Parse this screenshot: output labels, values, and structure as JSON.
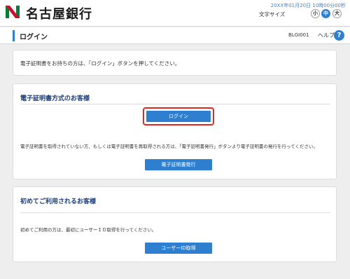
{
  "header": {
    "logo_icon": "bank-logo-icon",
    "bank_name": "名古屋銀行",
    "datetime": "20XX年01月20日 10時00分00秒",
    "font_size_label": "文字サイズ",
    "font_small": "小",
    "font_medium": "中",
    "font_large": "大",
    "brand_color": "#0a7a3a",
    "accent_color": "#2f7fd0"
  },
  "titlebar": {
    "title": "ログイン",
    "screen_id": "BLGI001",
    "help_label": "ヘルプ",
    "help_icon_glyph": "?"
  },
  "notice": {
    "text": "電子証明書をお持ちの方は、「ログイン」ボタンを押してください。"
  },
  "certificate_section": {
    "title": "電子証明書方式のお客様",
    "login_button": "ログイン",
    "description": "電子証明書を取得されていない方、もしくは電子証明書を再取得される方は、「電子証明書発行」ボタンより電子証明書の発行を行ってください。",
    "issue_button": "電子証明書発行",
    "highlight_color": "#e0281e"
  },
  "first_time_section": {
    "title": "初めてご利用されるお客様",
    "description": "初めてご利用の方は、最初にユーザーＩＤ取得を行ってください。",
    "userid_button": "ユーザーID取得"
  }
}
